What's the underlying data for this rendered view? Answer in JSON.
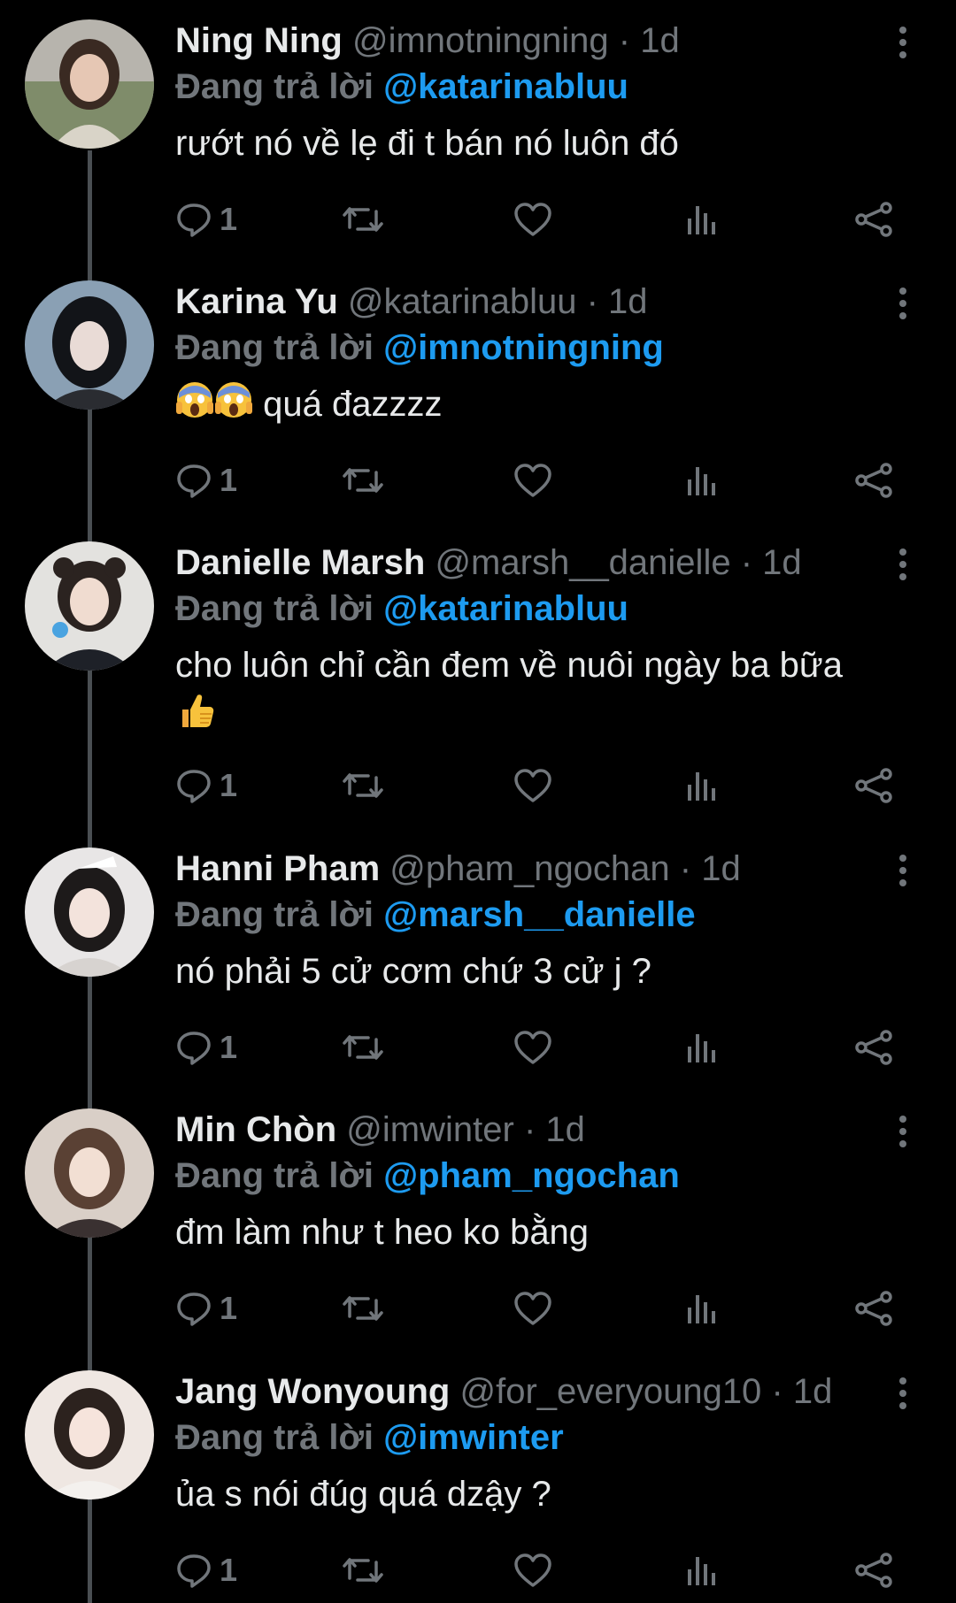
{
  "reply_prefix": "Đang trả lời",
  "tweets": [
    {
      "name": "Ning Ning",
      "handle": "@imnotningning",
      "time": "· 1d",
      "reply_to": "@katarinabluu",
      "text": "rướt nó về lẹ đi t bán nó luôn đó",
      "reply_count": "1"
    },
    {
      "name": "Karina Yu",
      "handle": "@katarinabluu",
      "time": "· 1d",
      "reply_to": "@imnotningning",
      "text": "quá đazzzz",
      "reply_count": "1"
    },
    {
      "name": "Danielle Marsh",
      "handle": "@marsh__danielle",
      "time": "· 1d",
      "reply_to": "@katarinabluu",
      "text": "cho luôn chỉ cần đem về nuôi ngày ba bữa",
      "reply_count": "1"
    },
    {
      "name": "Hanni Pham",
      "handle": "@pham_ngochan",
      "time": "· 1d",
      "reply_to": "@marsh__danielle",
      "text": "nó phải 5 cử cơm chứ 3 cử j ?",
      "reply_count": "1"
    },
    {
      "name": "Min Chòn",
      "handle": "@imwinter",
      "time": "· 1d",
      "reply_to": "@pham_ngochan",
      "text": "đm làm như t heo ko bằng",
      "reply_count": "1"
    },
    {
      "name": "Jang Wonyoung",
      "handle": "@for_everyoung10",
      "time": "· 1d",
      "reply_to": "@imwinter",
      "text": "ủa s nói đúg quá dzậy ?",
      "reply_count": "1"
    }
  ],
  "icons": {
    "reply": "reply-icon",
    "retweet": "retweet-icon",
    "like": "heart-icon",
    "views": "views-icon",
    "share": "share-icon",
    "more": "more-vertical-icon",
    "scream": "screaming-face-emoji",
    "thumbs": "thumbs-up-emoji"
  },
  "colors": {
    "background": "#000000",
    "text": "#e7e9ea",
    "muted": "#71767b",
    "link": "#1d9bf0",
    "line": "#4a4f53"
  }
}
